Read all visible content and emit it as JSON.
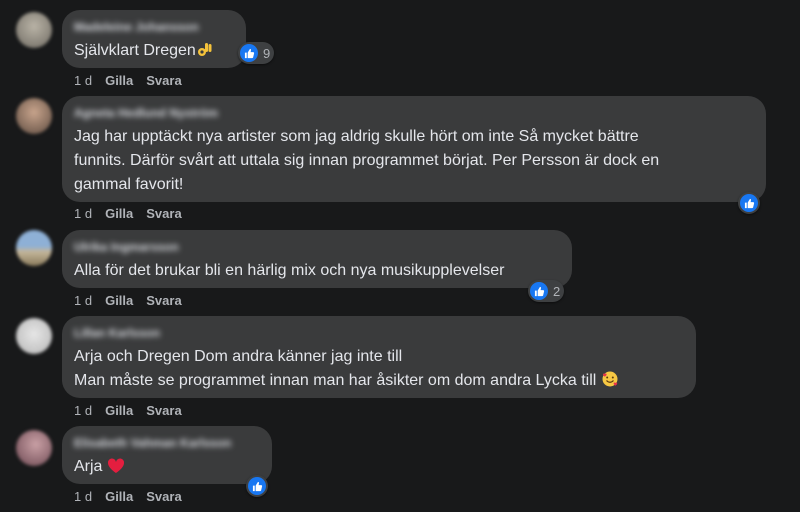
{
  "actions": {
    "time": "1 d",
    "like": "Gilla",
    "reply": "Svara"
  },
  "comments": [
    {
      "author": "Madeleine Johansson",
      "text": "Självklart Dregen",
      "emoji": "ok-hand-icon",
      "like_count": "9"
    },
    {
      "author": "Agneta Hedlund Nyström",
      "text": "Jag har upptäckt nya artister som jag aldrig skulle hört om inte Så mycket bättre\nfunnits. Därför svårt att uttala sig innan programmet börjat. Per Persson är dock en\ngammal favorit!"
    },
    {
      "author": "Ulrika Ingmarsson",
      "text": "Alla för det brukar bli en härlig mix och nya musikupplevelser",
      "like_count": "2"
    },
    {
      "author": "Lillan Karlsson",
      "text": "Arja och Dregen Dom andra känner jag inte till\nMan måste se programmet innan man har åsikter om dom andra Lycka till",
      "emoji": "smiling-face-with-hearts-icon"
    },
    {
      "author": "Elisabeth Vahman Karlsson",
      "text": "Arja",
      "emoji": "red-heart-icon"
    }
  ],
  "colors": {
    "background": "#18191a",
    "bubble": "#3a3b3c",
    "like": "#1877f2",
    "muted": "#b0b3b8"
  }
}
